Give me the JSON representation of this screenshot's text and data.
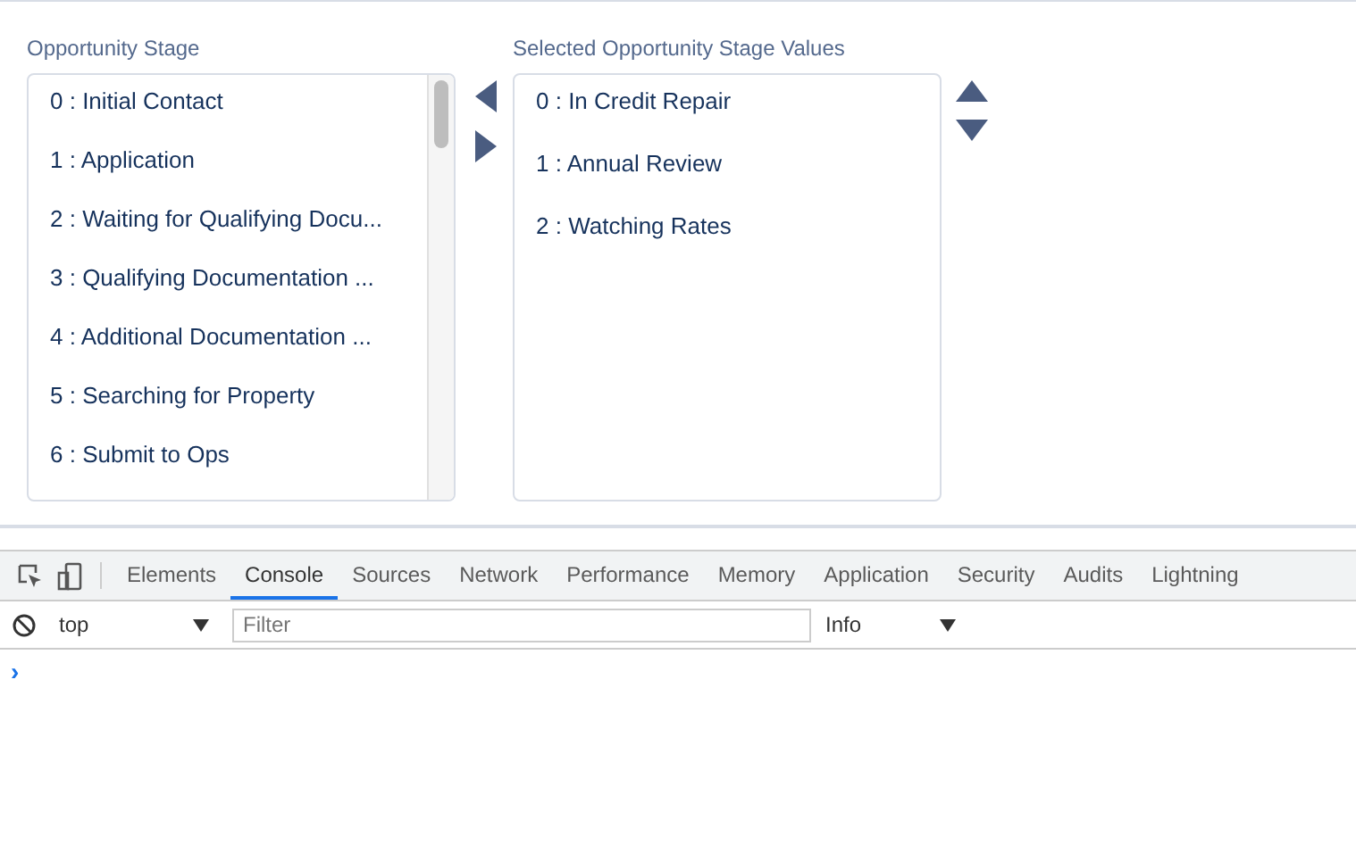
{
  "available": {
    "label": "Opportunity Stage",
    "options": [
      {
        "text": "0 : Initial Contact",
        "selected": false
      },
      {
        "text": "1 : Application",
        "selected": false
      },
      {
        "text": "2 : Waiting for Qualifying Docu...",
        "selected": false
      },
      {
        "text": "3 : Qualifying Documentation ...",
        "selected": false
      },
      {
        "text": "4 : Additional Documentation ...",
        "selected": false
      },
      {
        "text": "5 : Searching for Property",
        "selected": false
      },
      {
        "text": "6 : Submit to Ops",
        "selected": false
      }
    ]
  },
  "selected_list": {
    "label": "Selected Opportunity Stage Values",
    "options": [
      {
        "text": "0 : In Credit Repair",
        "selected": false
      },
      {
        "text": "1 : Annual Review",
        "selected": false
      },
      {
        "text": "2 : Watching Rates",
        "selected": false
      }
    ]
  },
  "devtools": {
    "tabs": [
      {
        "label": "Elements",
        "selected": false
      },
      {
        "label": "Console",
        "selected": true
      },
      {
        "label": "Sources",
        "selected": false
      },
      {
        "label": "Network",
        "selected": false
      },
      {
        "label": "Performance",
        "selected": false
      },
      {
        "label": "Memory",
        "selected": false
      },
      {
        "label": "Application",
        "selected": false
      },
      {
        "label": "Security",
        "selected": false
      },
      {
        "label": "Audits",
        "selected": false
      },
      {
        "label": "Lightning",
        "selected": false
      }
    ],
    "context": "top",
    "filter": {
      "placeholder": "Filter"
    },
    "level": "Info",
    "prompt": "›"
  }
}
